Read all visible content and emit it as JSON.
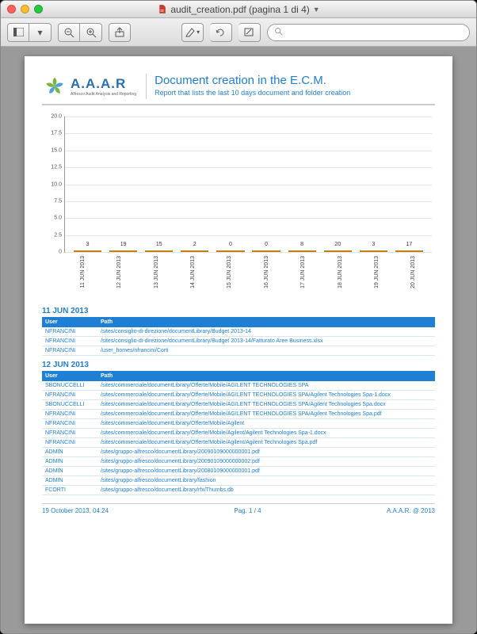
{
  "window": {
    "title": "audit_creation.pdf (pagina 1 di 4)"
  },
  "toolbar": {
    "search_placeholder": ""
  },
  "doc": {
    "logo_name": "A.A.A.R",
    "logo_sub": "Alfresco Audit Analysis and Reporting",
    "title": "Document creation in the E.C.M.",
    "subtitle": "Report that lists the last 10 days document and folder creation"
  },
  "chart_data": {
    "type": "bar",
    "categories": [
      "11 JUN 2013",
      "12 JUN 2013",
      "13 JUN 2013",
      "14 JUN 2013",
      "15 JUN 2013",
      "16 JUN 2013",
      "17 JUN 2013",
      "18 JUN 2013",
      "19 JUN 2013",
      "20 JUN 2013"
    ],
    "values": [
      3,
      19,
      15,
      2,
      0,
      0,
      8,
      20,
      3,
      17
    ],
    "title": "",
    "xlabel": "",
    "ylabel": "",
    "ylim": [
      0,
      20
    ],
    "yticks": [
      0,
      2.5,
      5.0,
      7.5,
      10.0,
      12.5,
      15.0,
      17.5,
      20.0
    ]
  },
  "sections": [
    {
      "heading": "11 JUN 2013",
      "header_user": "User",
      "header_path": "Path",
      "rows": [
        {
          "user": "NFRANCINI",
          "path": "/sites/consiglio-di-direzione/documentLibrary/Budget 2013-14"
        },
        {
          "user": "NFRANCINI",
          "path": "/sites/consiglio-di-direzione/documentLibrary/Budget 2013-14/Fatturato Aree Business.xlsx"
        },
        {
          "user": "NFRANCINI",
          "path": "/user_homes/nfrancini/Corti"
        }
      ]
    },
    {
      "heading": "12 JUN 2013",
      "header_user": "User",
      "header_path": "Path",
      "rows": [
        {
          "user": "SBONUCCELLI",
          "path": "/sites/commerciale/documentLibrary/Offerte/Mobile/AGILENT TECHNOLOGIES SPA"
        },
        {
          "user": "NFRANCINI",
          "path": "/sites/commerciale/documentLibrary/Offerte/Mobile/AGILENT TECHNOLOGIES SPA/Agilent Technologies Spa-1.docx"
        },
        {
          "user": "SBONUCCELLI",
          "path": "/sites/commerciale/documentLibrary/Offerte/Mobile/AGILENT TECHNOLOGIES SPA/Agilent Technologies Spa.docx"
        },
        {
          "user": "NFRANCINI",
          "path": "/sites/commerciale/documentLibrary/Offerte/Mobile/AGILENT TECHNOLOGIES SPA/Agilent Technologies Spa.pdf"
        },
        {
          "user": "NFRANCINI",
          "path": "/sites/commerciale/documentLibrary/Offerte/Mobile/Agilent"
        },
        {
          "user": "NFRANCINI",
          "path": "/sites/commerciale/documentLibrary/Offerte/Mobile/Agilent/Agilent Technologies Spa-1.docx"
        },
        {
          "user": "NFRANCINI",
          "path": "/sites/commerciale/documentLibrary/Offerte/Mobile/Agilent/Agilent Technologies Spa.pdf"
        },
        {
          "user": "ADMIN",
          "path": "/sites/gruppo-alfresco/documentLibrary/20090109000000001.pdf"
        },
        {
          "user": "ADMIN",
          "path": "/sites/gruppo-alfresco/documentLibrary/20090109000000002.pdf"
        },
        {
          "user": "ADMIN",
          "path": "/sites/gruppo-alfresco/documentLibrary/20080109000000001.pdf"
        },
        {
          "user": "ADMIN",
          "path": "/sites/gruppo-alfresco/documentLibrary/fashion"
        },
        {
          "user": "FCORTI",
          "path": "/sites/gruppo-alfresco/documentLibrary/rfx/Thumbs.db"
        }
      ]
    }
  ],
  "footer": {
    "left": "19 October 2013, 04:24",
    "center": "Pag. 1 / 4",
    "right": "A.A.A.R. @ 2013"
  }
}
